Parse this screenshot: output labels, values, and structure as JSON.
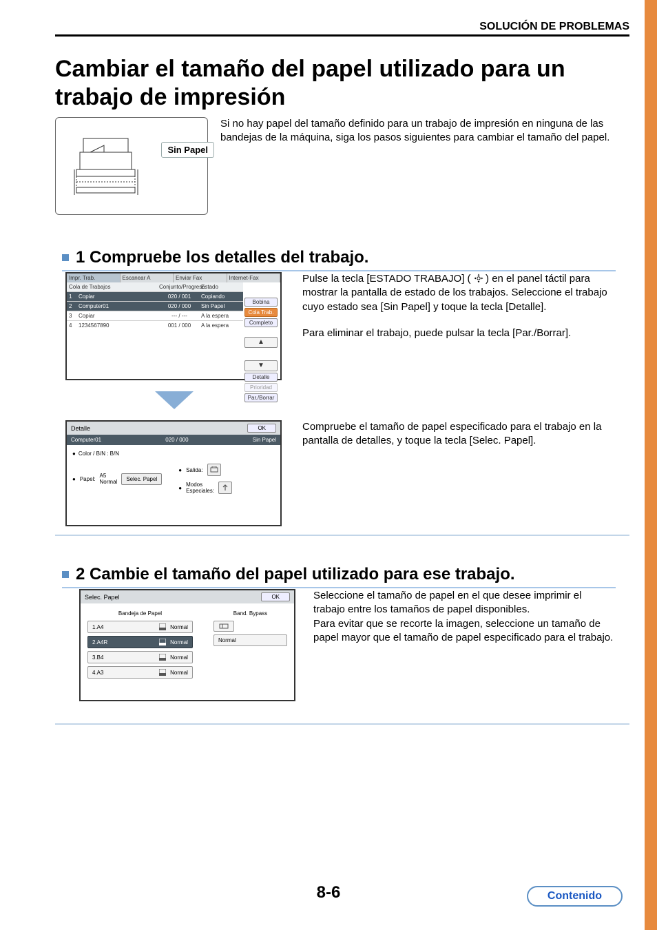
{
  "header": {
    "section": "SOLUCIÓN DE PROBLEMAS"
  },
  "title": "Cambiar el tamaño del papel utilizado para un trabajo de impresión",
  "intro": {
    "badge": "Sin Papel",
    "text": "Si no hay papel del tamaño definido para un trabajo de impresión en ninguna de las bandejas de la máquina, siga los pasos siguientes para cambiar el tamaño del papel."
  },
  "steps": {
    "s1": {
      "heading": "1 Compruebe los detalles del trabajo."
    },
    "s2": {
      "heading": "2 Cambie el tamaño del papel utilizado para ese trabajo."
    }
  },
  "screen1": {
    "tabs": [
      "Impr. Trab.",
      "Escanear A",
      "Enviar Fax",
      "Internet-Fax"
    ],
    "columns": {
      "c1": "Cola de Trabajos",
      "c2": "Conjunto/Progreso",
      "c3": "Estado"
    },
    "rows": [
      {
        "idx": "1",
        "name": "Copiar",
        "prog": "020 / 001",
        "stat": "Copiando",
        "dark": true
      },
      {
        "idx": "2",
        "name": "Computer01",
        "prog": "020 / 000",
        "stat": "Sin Papel",
        "highlight": true,
        "icon": true
      },
      {
        "idx": "3",
        "name": "Copiar",
        "prog": "--- / ---",
        "stat": "A la espera"
      },
      {
        "idx": "4",
        "name": "1234567890",
        "prog": "001 / 000",
        "stat": "A la espera"
      }
    ],
    "side": {
      "spool": "Bobina",
      "queue": "Cola Trab.",
      "done": "Completo",
      "up": "▲",
      "down": "▼",
      "detail": "Detalle",
      "priority": "Prioridad",
      "stopdel": "Par./Borrar"
    }
  },
  "desc1": {
    "p1": "Pulse la tecla [ESTADO TRABAJO] (",
    "p1b": ") en el panel táctil para mostrar la pantalla de estado de los trabajos. Seleccione el trabajo cuyo estado sea [Sin Papel] y toque la tecla [Detalle].",
    "p2": "Para eliminar el trabajo, puede pulsar la tecla [Par./Borrar]."
  },
  "screen2": {
    "title": "Detalle",
    "ok": "OK",
    "job": "Computer01",
    "prog": "020 / 000",
    "stat": "Sin Papel",
    "colorLine": "Color / B/N : B/N",
    "paperLabel": "Papel:",
    "paperVal": "A5\nNormal",
    "selectBtn": "Selec. Papel",
    "outLabel": "Salida:",
    "specialLabel": "Modos\nEspeciales:"
  },
  "desc2": "Compruebe el tamaño de papel especificado para el trabajo en la pantalla de detalles, y toque la tecla [Selec. Papel].",
  "screen3": {
    "title": "Selec. Papel",
    "ok": "OK",
    "colA": "Bandeja de Papel",
    "colB": "Band. Bypass",
    "trays": [
      {
        "label": "1.A4",
        "type": "Normal"
      },
      {
        "label": "2.A4R",
        "type": "Normal",
        "selected": true
      },
      {
        "label": "3.B4",
        "type": "Normal"
      },
      {
        "label": "4.A3",
        "type": "Normal"
      }
    ],
    "bypass": {
      "type": "Normal"
    }
  },
  "desc3": "Seleccione el tamaño de papel en el que desee imprimir el trabajo entre los tamaños de papel disponibles.\nPara evitar que se recorte la imagen, seleccione un tamaño de papel mayor que el tamaño de papel especificado para el trabajo.",
  "pageNumber": "8-6",
  "contentsButton": "Contenido"
}
